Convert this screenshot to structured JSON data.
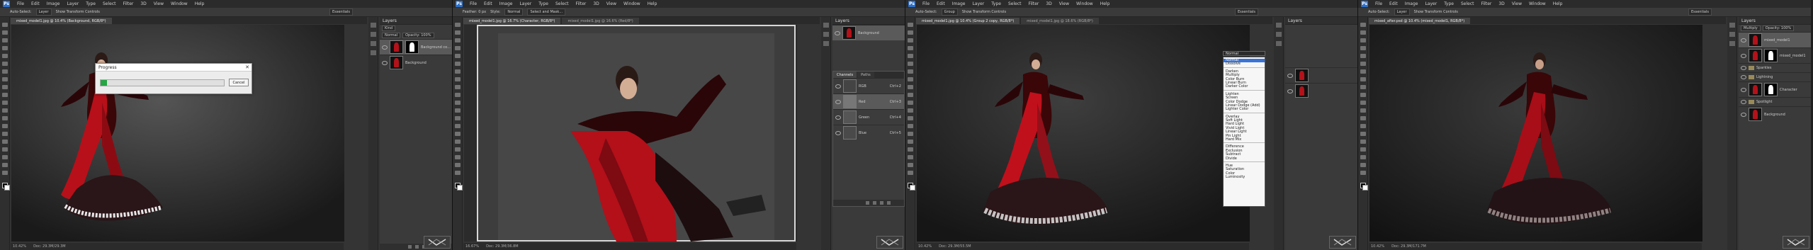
{
  "app": {
    "logo": "Ps",
    "menus": [
      "File",
      "Edit",
      "Image",
      "Layer",
      "Type",
      "Select",
      "Filter",
      "3D",
      "View",
      "Window",
      "Help"
    ]
  },
  "panels": [
    {
      "options": {
        "auto_select": "Auto-Select:",
        "auto_select_value": "Layer",
        "show_transform": "Show Transform Controls",
        "workspace": "Essentials"
      },
      "tabs": [
        "mixed_model1.jpg @ 10.4% (Background, RGB/8*)"
      ],
      "status": {
        "zoom": "10.42%",
        "doc": "Doc: 29.3M/29.3M"
      },
      "layers_title": "Layers",
      "kind": "Kind",
      "mode": "Normal",
      "opacity": "Opacity: 100%",
      "layers": [
        {
          "name": "Background co...",
          "has_mask": true
        },
        {
          "name": "Background",
          "has_mask": false
        }
      ],
      "dialog": {
        "title": "Progress",
        "close": "✕",
        "button": "Cancel",
        "progress": 0.05
      }
    },
    {
      "options": {
        "feather": "Feather: 0 px",
        "style": "Style:",
        "style_value": "Normal",
        "refine": "Select and Mask..."
      },
      "tabs": [
        "mixed_model1.jpg @ 16.7% (Character, RGB/8*)",
        "mixed_model1.jpg @ 16.6% (Red/8*)"
      ],
      "status": {
        "zoom": "16.67%",
        "doc": "Doc: 29.3M/36.8M"
      },
      "layers_title": "Layers",
      "channels_tabs": [
        "Channels",
        "Paths"
      ],
      "channels": [
        {
          "name": "RGB",
          "shortcut": "Ctrl+2"
        },
        {
          "name": "Red",
          "shortcut": "Ctrl+3"
        },
        {
          "name": "Green",
          "shortcut": "Ctrl+4"
        },
        {
          "name": "Blue",
          "shortcut": "Ctrl+5"
        }
      ],
      "top_layer": "Background"
    },
    {
      "options": {
        "auto_select": "Auto-Select:",
        "auto_select_value": "Group",
        "show_transform": "Show Transform Controls",
        "workspace": "Essentials"
      },
      "tabs": [
        "mixed_model1.jpg @ 10.4% (Group 2 copy, RGB/8*)",
        "mixed_model1.jpg @ 18.6% (RGB/8*)"
      ],
      "status": {
        "zoom": "10.42%",
        "doc": "Doc: 29.3M/55.5M"
      },
      "layers_title": "Layers",
      "blend_field": "Normal",
      "blend_modes": [
        [
          "Normal",
          "Dissolve"
        ],
        [
          "Darken",
          "Multiply",
          "Color Burn",
          "Linear Burn",
          "Darker Color"
        ],
        [
          "Lighten",
          "Screen",
          "Color Dodge",
          "Linear Dodge (Add)",
          "Lighter Color"
        ],
        [
          "Overlay",
          "Soft Light",
          "Hard Light",
          "Vivid Light",
          "Linear Light",
          "Pin Light",
          "Hard Mix"
        ],
        [
          "Difference",
          "Exclusion",
          "Subtract",
          "Divide"
        ],
        [
          "Hue",
          "Saturation",
          "Color",
          "Luminosity"
        ]
      ],
      "selected_mode": "Normal"
    },
    {
      "options": {
        "auto_select": "Auto-Select:",
        "auto_select_value": "Layer",
        "show_transform": "Show Transform Controls",
        "workspace": "Essentials"
      },
      "tabs": [
        "mixed_after.psd @ 10.4% (mixed_model1, RGB/8*)"
      ],
      "status": {
        "zoom": "10.42%",
        "doc": "Doc: 29.3M/171.7M"
      },
      "layers_title": "Layers",
      "mode": "Multiply",
      "opacity": "Opacity: 100%",
      "layer_items": [
        {
          "name": "mixed_model1",
          "type": "layer"
        },
        {
          "name": "mixed_model1",
          "type": "masked"
        },
        {
          "name": "Sparkles",
          "type": "group"
        },
        {
          "name": "Lightning",
          "type": "group"
        },
        {
          "name": "Character",
          "type": "masked"
        },
        {
          "name": "Spotlight",
          "type": "group"
        },
        {
          "name": "Background",
          "type": "layer"
        }
      ]
    }
  ]
}
